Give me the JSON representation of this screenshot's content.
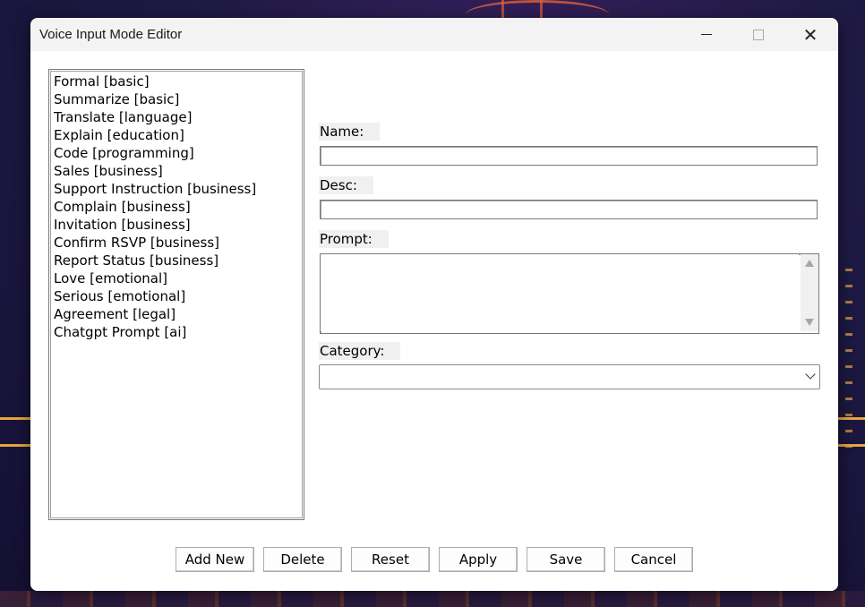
{
  "window": {
    "title": "Voice Input Mode Editor",
    "minimize_icon": "minimize-icon",
    "maximize_icon": "maximize-icon",
    "close_icon": "close-icon",
    "close_glyph": "✕"
  },
  "modes_list": {
    "items": [
      "Formal [basic]",
      "Summarize [basic]",
      "Translate [language]",
      "Explain [education]",
      "Code [programming]",
      "Sales [business]",
      "Support Instruction [business]",
      "Complain [business]",
      "Invitation [business]",
      "Confirm RSVP [business]",
      "Report Status [business]",
      "Love [emotional]",
      "Serious [emotional]",
      "Agreement [legal]",
      "Chatgpt Prompt [ai]"
    ]
  },
  "form": {
    "name_label": "Name:",
    "name_value": "",
    "desc_label": "Desc:",
    "desc_value": "",
    "prompt_label": "Prompt:",
    "prompt_value": "",
    "category_label": "Category:",
    "category_value": ""
  },
  "buttons": {
    "add_new": "Add New",
    "delete": "Delete",
    "reset": "Reset",
    "apply": "Apply",
    "save": "Save",
    "cancel": "Cancel"
  },
  "colors": {
    "titlebar": "#f3f3f3",
    "label_bg": "#f0f0f0",
    "desktop_accent": "#e8a640"
  }
}
